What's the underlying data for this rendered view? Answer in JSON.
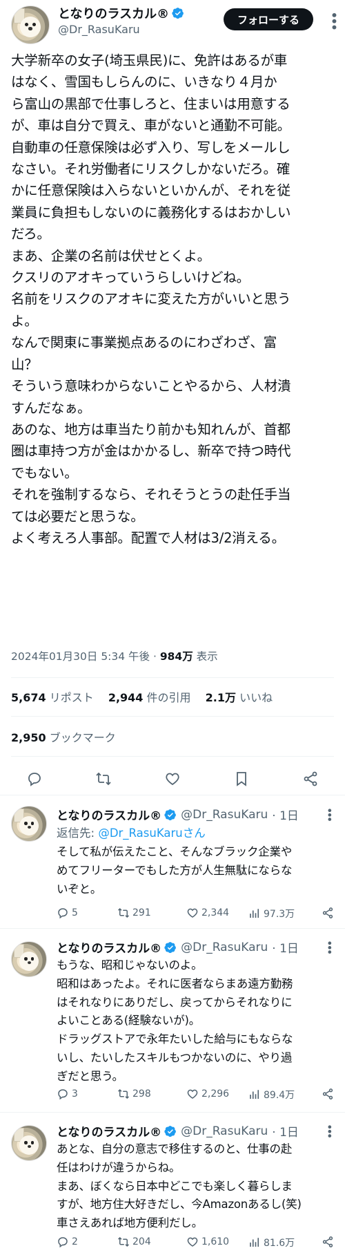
{
  "main": {
    "name": "となりのラスカル®",
    "handle": "@Dr_RasuKaru",
    "follow_label": "フォローする",
    "text_lines": [
      "大学新卒の女子(埼玉県民)に、免許はあるが車",
      "はなく、雪国もしらんのに、いきなり４月か",
      "ら富山の黒部で仕事しろと、住まいは用意する",
      "が、車は自分で買え、車がないと通勤不可能。",
      "自動車の任意保険は必ず入り、写しをメールし",
      "なさい。それ労働者にリスクしかないだろ。確",
      "かに任意保険は入らないといかんが、それを従",
      "業員に負担もしないのに義務化するはおかしい",
      "だろ。",
      "まあ、企業の名前は伏せとくよ。",
      "クスリのアオキっていうらしいけどね。",
      "名前をリスクのアオキに変えた方がいいと思う",
      "よ。",
      "なんで関東に事業拠点あるのにわざわざ、富",
      "山？",
      "そういう意味わからないことやるから、人材潰",
      "すんだなぁ。",
      "あのな、地方は車当たり前かも知れんが、首都",
      "圏は車持つ方が金はかかるし、新卒で持つ時代",
      "でもない。",
      "それを強制するなら、それそうとうの赴任手当",
      "ては必要だと思うな。",
      "よく考えろ人事部。配置で人材は3/2消える。"
    ],
    "timestamp": "2024年01月30日 5:34 午後",
    "views_count": "984万",
    "views_label": "表示",
    "reposts_count": "5,674",
    "reposts_label": "リポスト",
    "quotes_count": "2,944",
    "quotes_label": "件の引用",
    "likes_count": "2.1万",
    "likes_label": "いいね",
    "bookmarks_count": "2,950",
    "bookmarks_label": "ブックマーク"
  },
  "replies": [
    {
      "name": "となりのラスカル®",
      "handle": "@Dr_RasuKaru",
      "time": "· 1日",
      "reply_to_prefix": "返信先: ",
      "reply_to_mention": "@Dr_RasuKaruさん",
      "lines": [
        "そして私が伝えたこと、そんなブラック企業や",
        "めてフリーターでもした方が人生無駄にならな",
        "いぞと。"
      ],
      "replies": "5",
      "reposts": "291",
      "likes": "2,344",
      "views": "97.3万"
    },
    {
      "name": "となりのラスカル®",
      "handle": "@Dr_RasuKaru",
      "time": "· 1日",
      "lines": [
        "もうな、昭和じゃないのよ。",
        "昭和はあったよ。それに医者ならまあ遠方勤務",
        "はそれなりにありだし、戻ってからそれなりに",
        "よいことある(経験ないが)。",
        "ドラッグストアで永年たいした給与にもならな",
        "いし、たいしたスキルもつかないのに、やり過",
        "ぎだと思う。"
      ],
      "replies": "3",
      "reposts": "298",
      "likes": "2,296",
      "views": "89.4万"
    },
    {
      "name": "となりのラスカル®",
      "handle": "@Dr_RasuKaru",
      "time": "· 1日",
      "lines": [
        "あとな、自分の意志で移住するのと、仕事の赴",
        "任はわけが違うからね。",
        "まあ、ぼくなら日本中どこでも楽しく暮らしま",
        "すが、地方住大好きだし、今Amazonあるし(笑)",
        "車さえあれば地方便利だし。"
      ],
      "replies": "2",
      "reposts": "204",
      "likes": "1,610",
      "views": "81.6万"
    }
  ],
  "colors": {
    "accent": "#1d9bf0",
    "text": "#0f1419",
    "muted": "#536471",
    "divider": "#eff3f4"
  }
}
